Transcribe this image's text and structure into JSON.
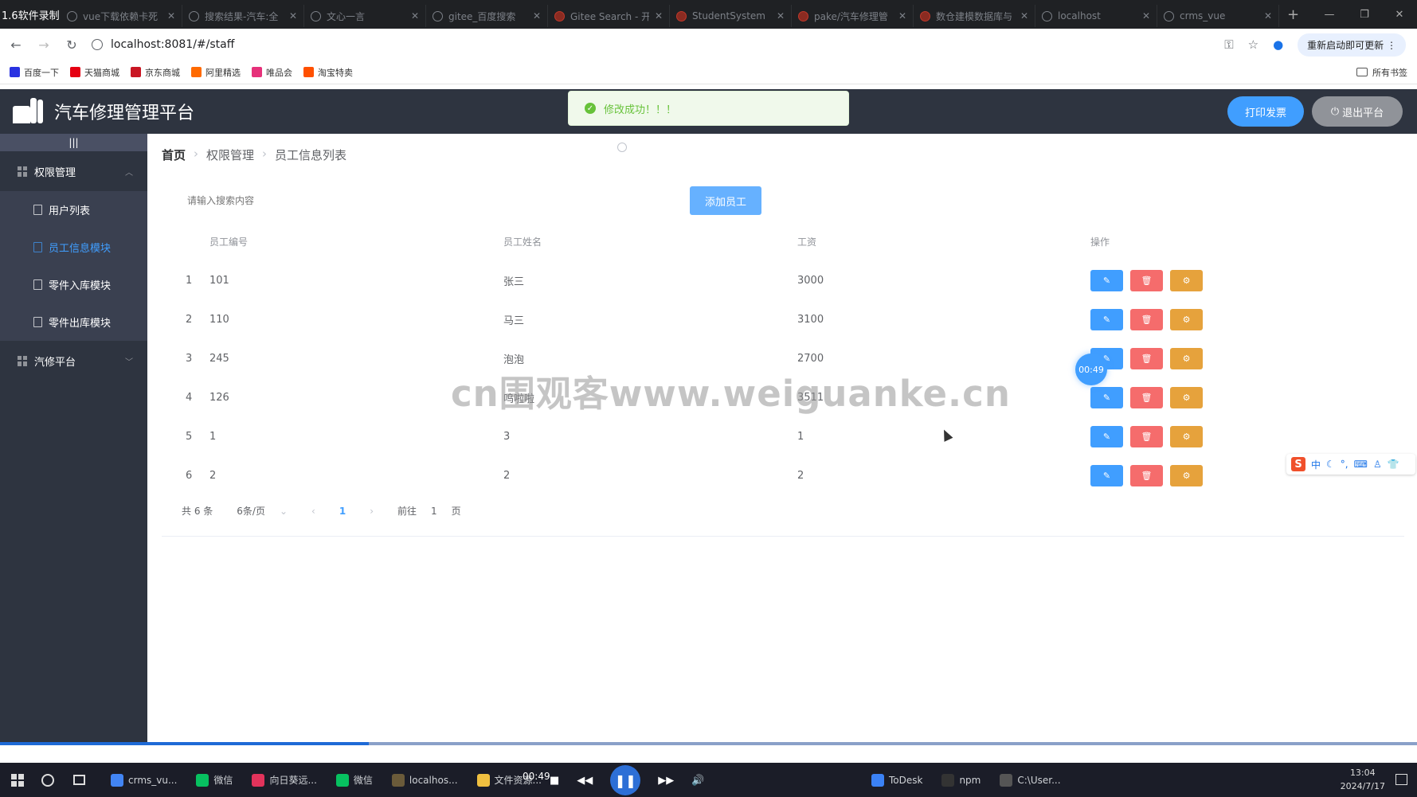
{
  "recorder_label": "1.6软件录制",
  "browser_tabs": [
    {
      "label": "vue下载依赖卡死",
      "icon": "doc-icon"
    },
    {
      "label": "搜索结果-汽车:全",
      "icon": "doc-icon"
    },
    {
      "label": "文心一言",
      "icon": "doc-icon"
    },
    {
      "label": "gitee_百度搜索",
      "icon": "paw-icon"
    },
    {
      "label": "Gitee Search - 开",
      "icon": "gitee-icon"
    },
    {
      "label": "StudentSystem",
      "icon": "gitee-icon"
    },
    {
      "label": "pake/汽车修理管",
      "icon": "gitee-icon"
    },
    {
      "label": "数仓建模数据库与",
      "icon": "gitee-icon"
    },
    {
      "label": "localhost",
      "icon": "globe-icon"
    },
    {
      "label": "crms_vue",
      "icon": "vue-icon"
    }
  ],
  "url": "localhost:8081/#/staff",
  "update_button": "重新启动即可更新",
  "bookmarks": [
    {
      "label": "百度一下",
      "color": "#2932e1"
    },
    {
      "label": "天猫商城",
      "color": "#e50012"
    },
    {
      "label": "京东商城",
      "color": "#c91623"
    },
    {
      "label": "阿里精选",
      "color": "#ff6a00"
    },
    {
      "label": "唯品会",
      "color": "#e6317a"
    },
    {
      "label": "淘宝特卖",
      "color": "#ff5000"
    }
  ],
  "all_bookmarks": "所有书签",
  "app": {
    "title": "汽车修理管理平台",
    "print_button": "打印发票",
    "exit_button": "退出平台",
    "toast": "修改成功！！！"
  },
  "sidebar": {
    "toggle": "|||",
    "groups": [
      {
        "label": "权限管理",
        "arrow": "︿",
        "items": [
          "用户列表",
          "员工信息模块",
          "零件入库模块",
          "零件出库模块"
        ]
      },
      {
        "label": "汽修平台",
        "arrow": "﹀"
      }
    ]
  },
  "breadcrumb": [
    "首页",
    "权限管理",
    "员工信息列表"
  ],
  "search": {
    "placeholder": "请输入搜索内容"
  },
  "add_button": "添加员工",
  "table": {
    "headers": [
      "员工编号",
      "员工姓名",
      "工资",
      "操作"
    ],
    "rows": [
      {
        "index": "1",
        "id": "101",
        "name": "张三",
        "salary": "3000"
      },
      {
        "index": "2",
        "id": "110",
        "name": "马三",
        "salary": "3100"
      },
      {
        "index": "3",
        "id": "245",
        "name": "泡泡",
        "salary": "2700"
      },
      {
        "index": "4",
        "id": "126",
        "name": "呜啦啦",
        "salary": "3511"
      },
      {
        "index": "5",
        "id": "1",
        "name": "3",
        "salary": "1"
      },
      {
        "index": "6",
        "id": "2",
        "name": "2",
        "salary": "2"
      }
    ]
  },
  "pagination": {
    "total": "共 6 条",
    "page_size": "6条/页",
    "current": "1",
    "goto_label": "前往",
    "goto_value": "1",
    "page_unit": "页"
  },
  "timer_badge": "00:49",
  "watermark": "cn围观客www.weiguanke.cn",
  "ime_label": "中",
  "player": {
    "time": "00:49",
    "progress": 0.26
  },
  "taskbar": {
    "apps": [
      {
        "label": "crms_vu...",
        "color": "#4285f4"
      },
      {
        "label": "微信",
        "color": "#07c160"
      },
      {
        "label": "向日葵远...",
        "color": "#e2335b"
      },
      {
        "label": "微信",
        "color": "#07c160"
      },
      {
        "label": "localhos...",
        "color": "#6b5b3a"
      },
      {
        "label": "文件资源...",
        "color": "#f0c040"
      }
    ],
    "right_apps": [
      {
        "label": "ToDesk",
        "color": "#3b82f6"
      },
      {
        "label": "npm",
        "color": "#333333"
      },
      {
        "label": "C:\\User...",
        "color": "#555555"
      }
    ],
    "clock_time": "13:04",
    "clock_date": "2024/7/17"
  }
}
